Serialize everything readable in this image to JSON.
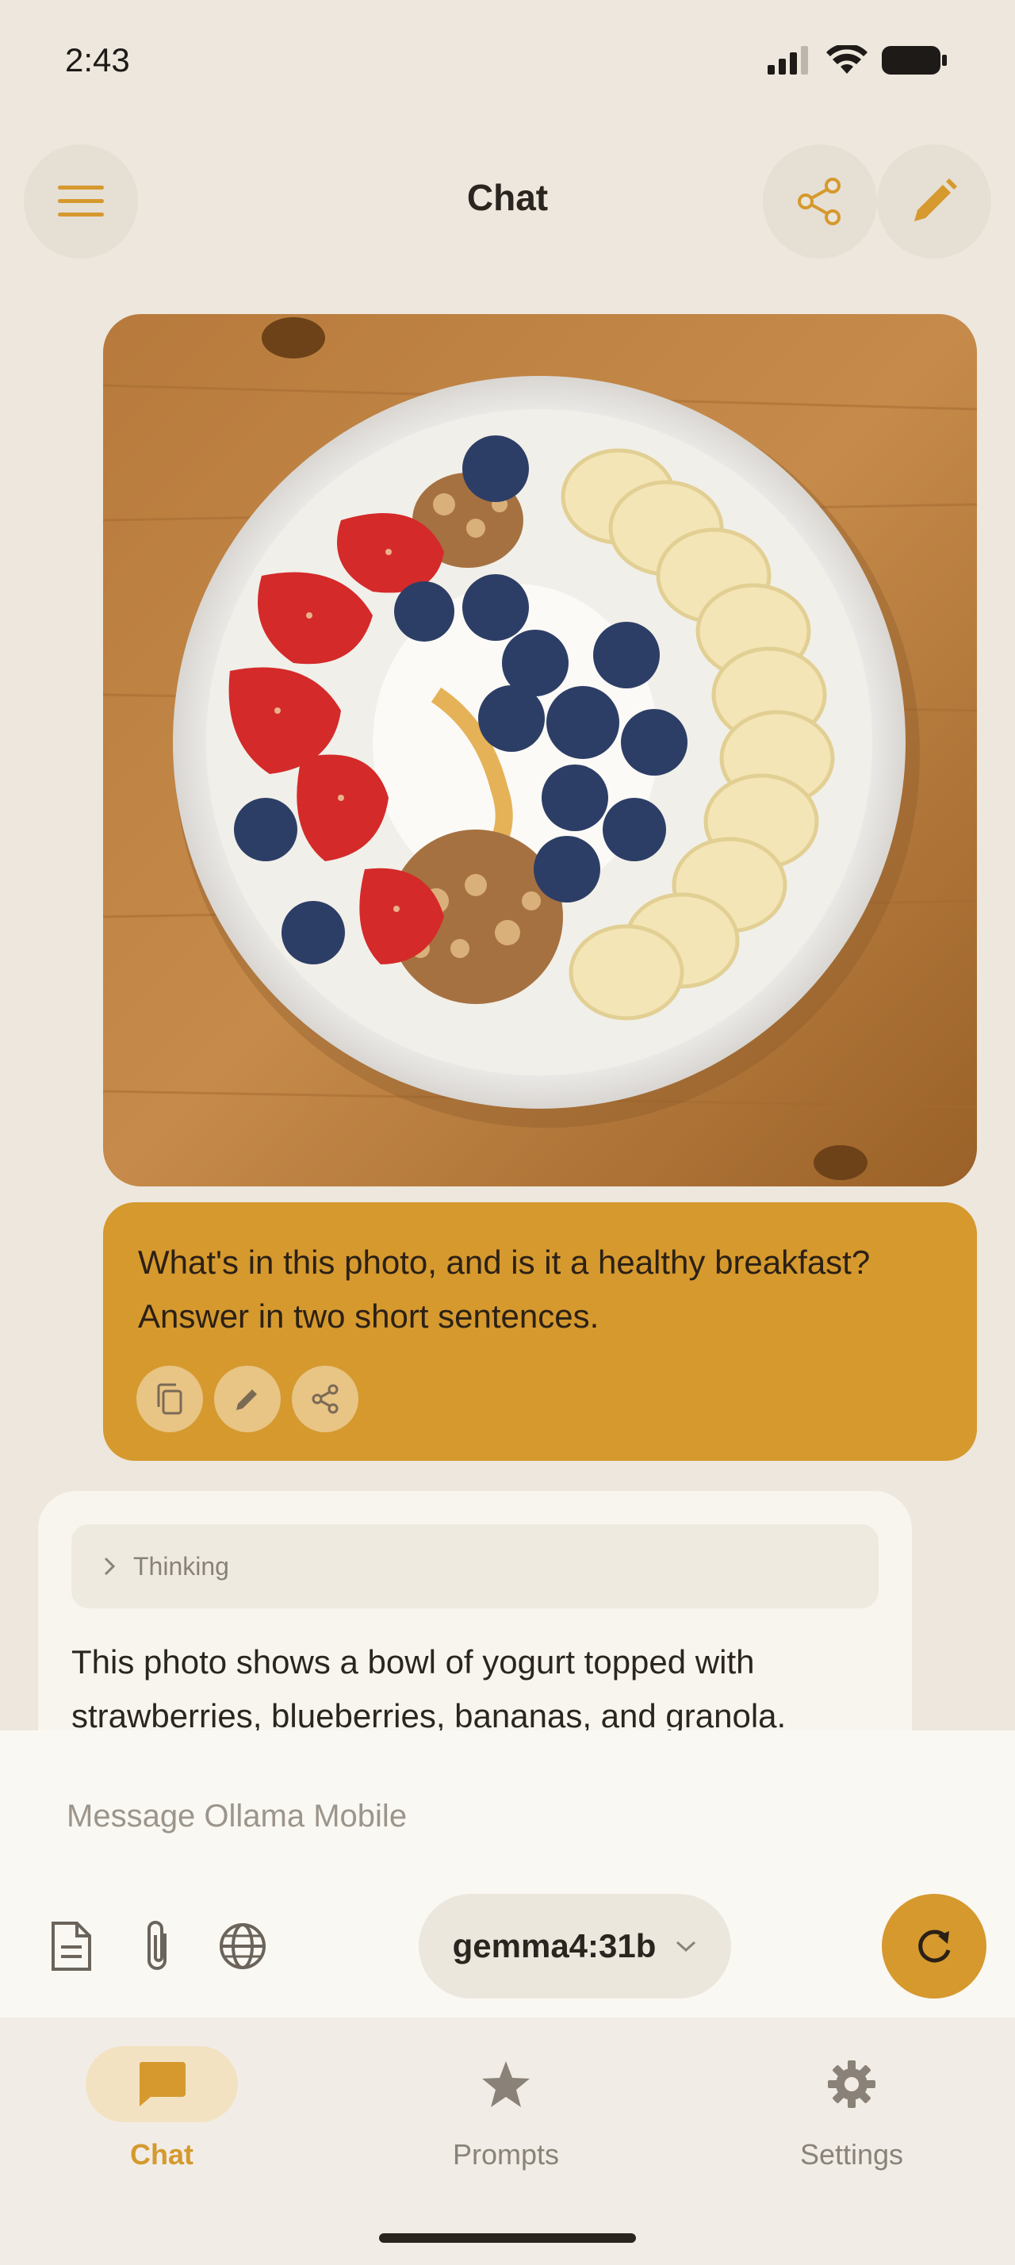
{
  "status_bar": {
    "time": "2:43"
  },
  "header": {
    "title": "Chat",
    "menu_icon": "hamburger-menu-icon",
    "share_icon": "share-icon",
    "edit_icon": "pencil-icon"
  },
  "conversation": {
    "user_message": {
      "image_description_icon": "food-photo",
      "text": "What's in this photo, and is it a healthy breakfast? Answer in two short sentences.",
      "actions": [
        "copy-icon",
        "pencil-icon",
        "share-icon"
      ]
    },
    "assistant_message": {
      "thinking_label": "Thinking",
      "text": "This photo shows a bowl of yogurt topped with strawberries, blueberries, bananas, and granola."
    }
  },
  "composer": {
    "placeholder": "Message Ollama Mobile",
    "tools": [
      "document-icon",
      "paperclip-icon",
      "globe-icon"
    ],
    "model": "gemma4:31b",
    "send_icon": "refresh-icon"
  },
  "bottom_nav": {
    "items": [
      {
        "label": "Chat",
        "icon": "chat-bubble-icon",
        "active": true
      },
      {
        "label": "Prompts",
        "icon": "star-icon",
        "active": false
      },
      {
        "label": "Settings",
        "icon": "gear-icon",
        "active": false
      }
    ]
  },
  "colors": {
    "accent": "#d5992e",
    "background": "#ede7dd",
    "text": "#2b2520",
    "muted": "#8a8278"
  }
}
